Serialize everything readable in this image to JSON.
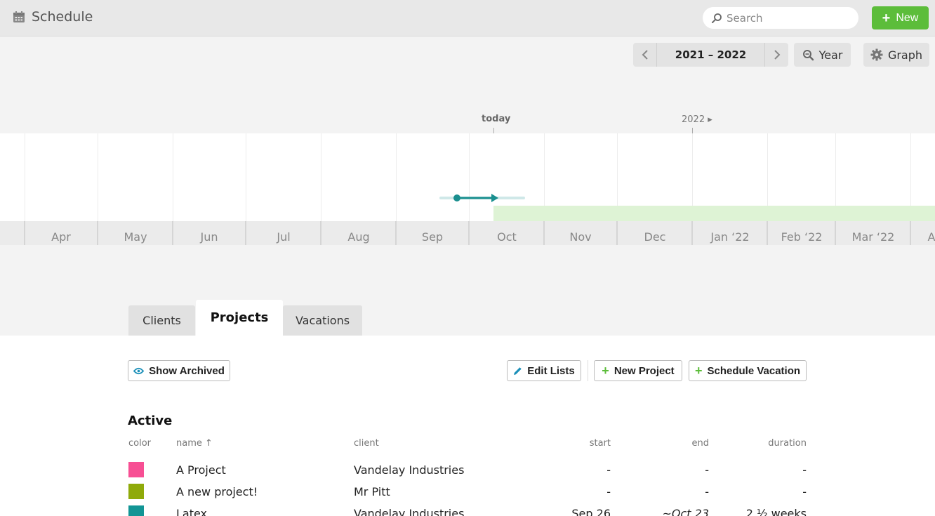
{
  "header": {
    "title": "Schedule",
    "search_placeholder": "Search",
    "new_label": "New"
  },
  "toolbar": {
    "range": "2021 – 2022",
    "zoom_label": "Year",
    "graph_label": "Graph"
  },
  "timeline": {
    "today_label": "today",
    "year_marker": "2022 ▸",
    "months": [
      "Apr",
      "May",
      "Jun",
      "Jul",
      "Aug",
      "Sep",
      "Oct",
      "Nov",
      "Dec",
      "Jan ‘22",
      "Feb ‘22",
      "Mar ‘22",
      "A"
    ],
    "colors": {
      "bar": "#1a8f8f",
      "bar_track": "#cfe8e8",
      "band": "#def3d5"
    }
  },
  "tabs": [
    {
      "label": "Clients",
      "active": false
    },
    {
      "label": "Projects",
      "active": true
    },
    {
      "label": "Vacations",
      "active": false
    }
  ],
  "actions": {
    "show_archived": "Show Archived",
    "edit_lists": "Edit Lists",
    "new_project": "New Project",
    "schedule_vacation": "Schedule Vacation"
  },
  "section": {
    "title": "Active",
    "columns": {
      "color": "color",
      "name": "name ↑",
      "client": "client",
      "start": "start",
      "end": "end",
      "duration": "duration"
    },
    "rows": [
      {
        "color": "#f74f94",
        "name": "A Project",
        "client": "Vandelay Industries",
        "start": "-",
        "end": "-",
        "duration": "-"
      },
      {
        "color": "#8faa0a",
        "name": "A new project!",
        "client": "Mr Pitt",
        "start": "-",
        "end": "-",
        "duration": "-"
      },
      {
        "color": "#129595",
        "name": "Latex",
        "client": "Vandelay Industries",
        "start": "Sep 26",
        "end": "~Oct 23",
        "duration": "2 ½ weeks"
      }
    ]
  }
}
